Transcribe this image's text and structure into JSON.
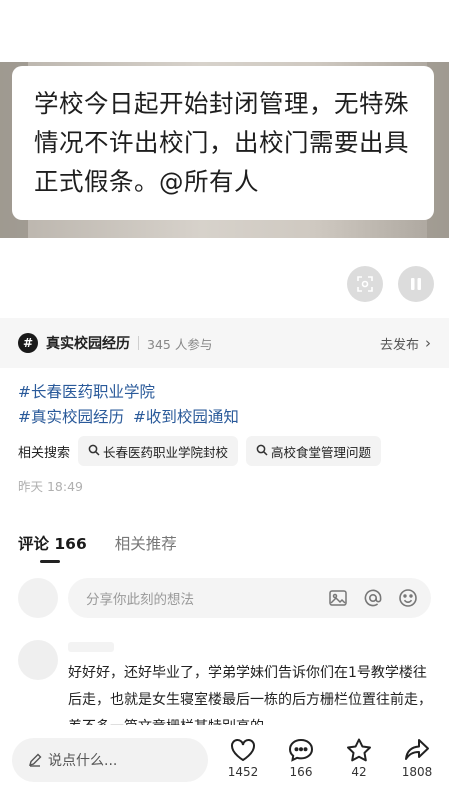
{
  "video": {
    "caption": "学校今日起开始封闭管理，无特殊情况不许出校门，出校门需要出具正式假条。@所有人"
  },
  "topic": {
    "name": "真实校园经历",
    "participants": "345 人参与",
    "action": "去发布"
  },
  "hashtags": {
    "line1": [
      "#长春医药职业学院"
    ],
    "line2": [
      "#真实校园经历",
      "#收到校园通知"
    ]
  },
  "related": {
    "label": "相关搜索",
    "chips": [
      "长春医药职业学院封校",
      "高校食堂管理问题"
    ]
  },
  "post_time": "昨天 18:49",
  "tabs": [
    "评论 166",
    "相关推荐"
  ],
  "composer": {
    "placeholder": "分享你此刻的想法"
  },
  "comment": {
    "text": "好好好，还好毕业了，学弟学妹们告诉你们在1号教学楼往后走，也就是女生寝室楼最后一栋的后方栅栏位置往前走，差不多一篇文章栅栏某特别高的"
  },
  "bottom": {
    "say_placeholder": "说点什么...",
    "likes": "1452",
    "comments": "166",
    "favorites": "42",
    "shares": "1808"
  }
}
